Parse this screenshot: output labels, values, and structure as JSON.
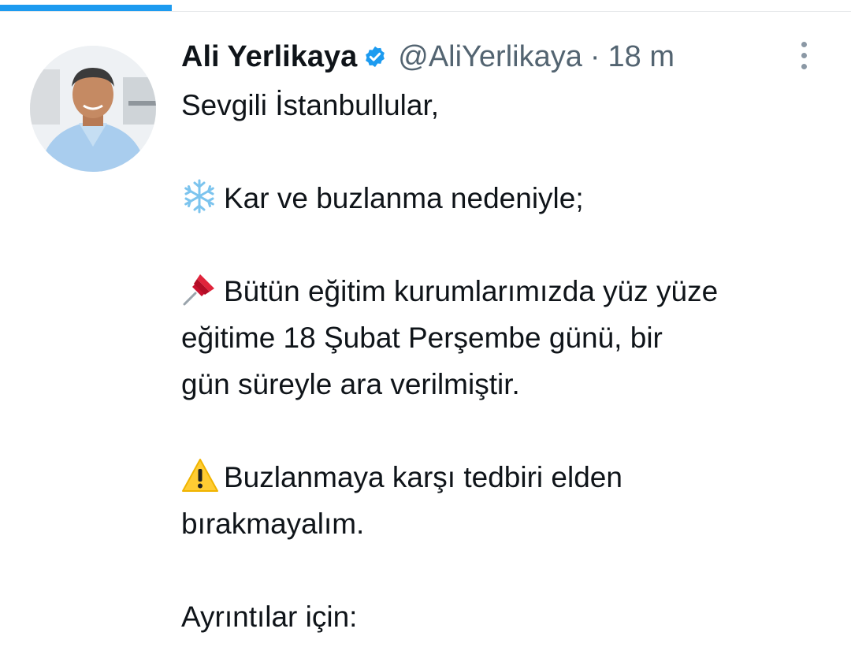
{
  "tweet": {
    "author_name": "Ali Yerlikaya",
    "handle": "@AliYerlikaya",
    "separator": "·",
    "time": "18 m",
    "lines": {
      "greeting": "Sevgili İstanbullular,",
      "cause": "Kar ve buzlanma nedeniyle;",
      "notice_1": "Bütün eğitim kurumlarımızda yüz yüze",
      "notice_2": "eğitime 18 Şubat Perşembe günü, bir",
      "notice_3": "gün süreyle ara verilmiştir.",
      "warning_1": "Buzlanmaya karşı tedbiri elden",
      "warning_2": "bırakmayalım.",
      "details": "Ayrıntılar için:"
    },
    "icons": {
      "verified": "verified-badge-icon",
      "more": "more-options-icon",
      "snowflake": "snowflake-emoji",
      "pushpin": "pushpin-emoji",
      "warning": "warning-emoji"
    }
  },
  "colors": {
    "accent": "#1d9bf0",
    "text": "#0f1419",
    "secondary": "#536471"
  }
}
